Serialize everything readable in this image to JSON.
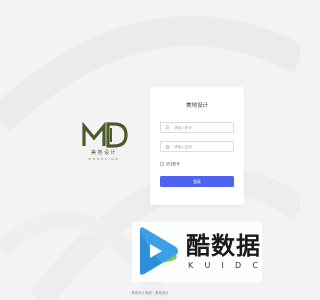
{
  "logo": {
    "mark_text": "MD",
    "name_cn": "美地设计",
    "name_en": "MODESIGN",
    "color": "#4a5a2b"
  },
  "login": {
    "title": "美地设计",
    "username_placeholder": "请输入账号",
    "password_placeholder": "请输入密码",
    "username_icon": "user-icon",
    "password_icon": "lock-icon",
    "remember_label": "记住账号",
    "button_label": "登录",
    "accent_color": "#4f63f3"
  },
  "watermark": {
    "name_cn": "酷数据",
    "letters": [
      "K",
      "U",
      "I",
      "D",
      "C"
    ],
    "icon": "play-icon"
  },
  "footer": {
    "text": "美地设计系统 · 美地设计"
  }
}
